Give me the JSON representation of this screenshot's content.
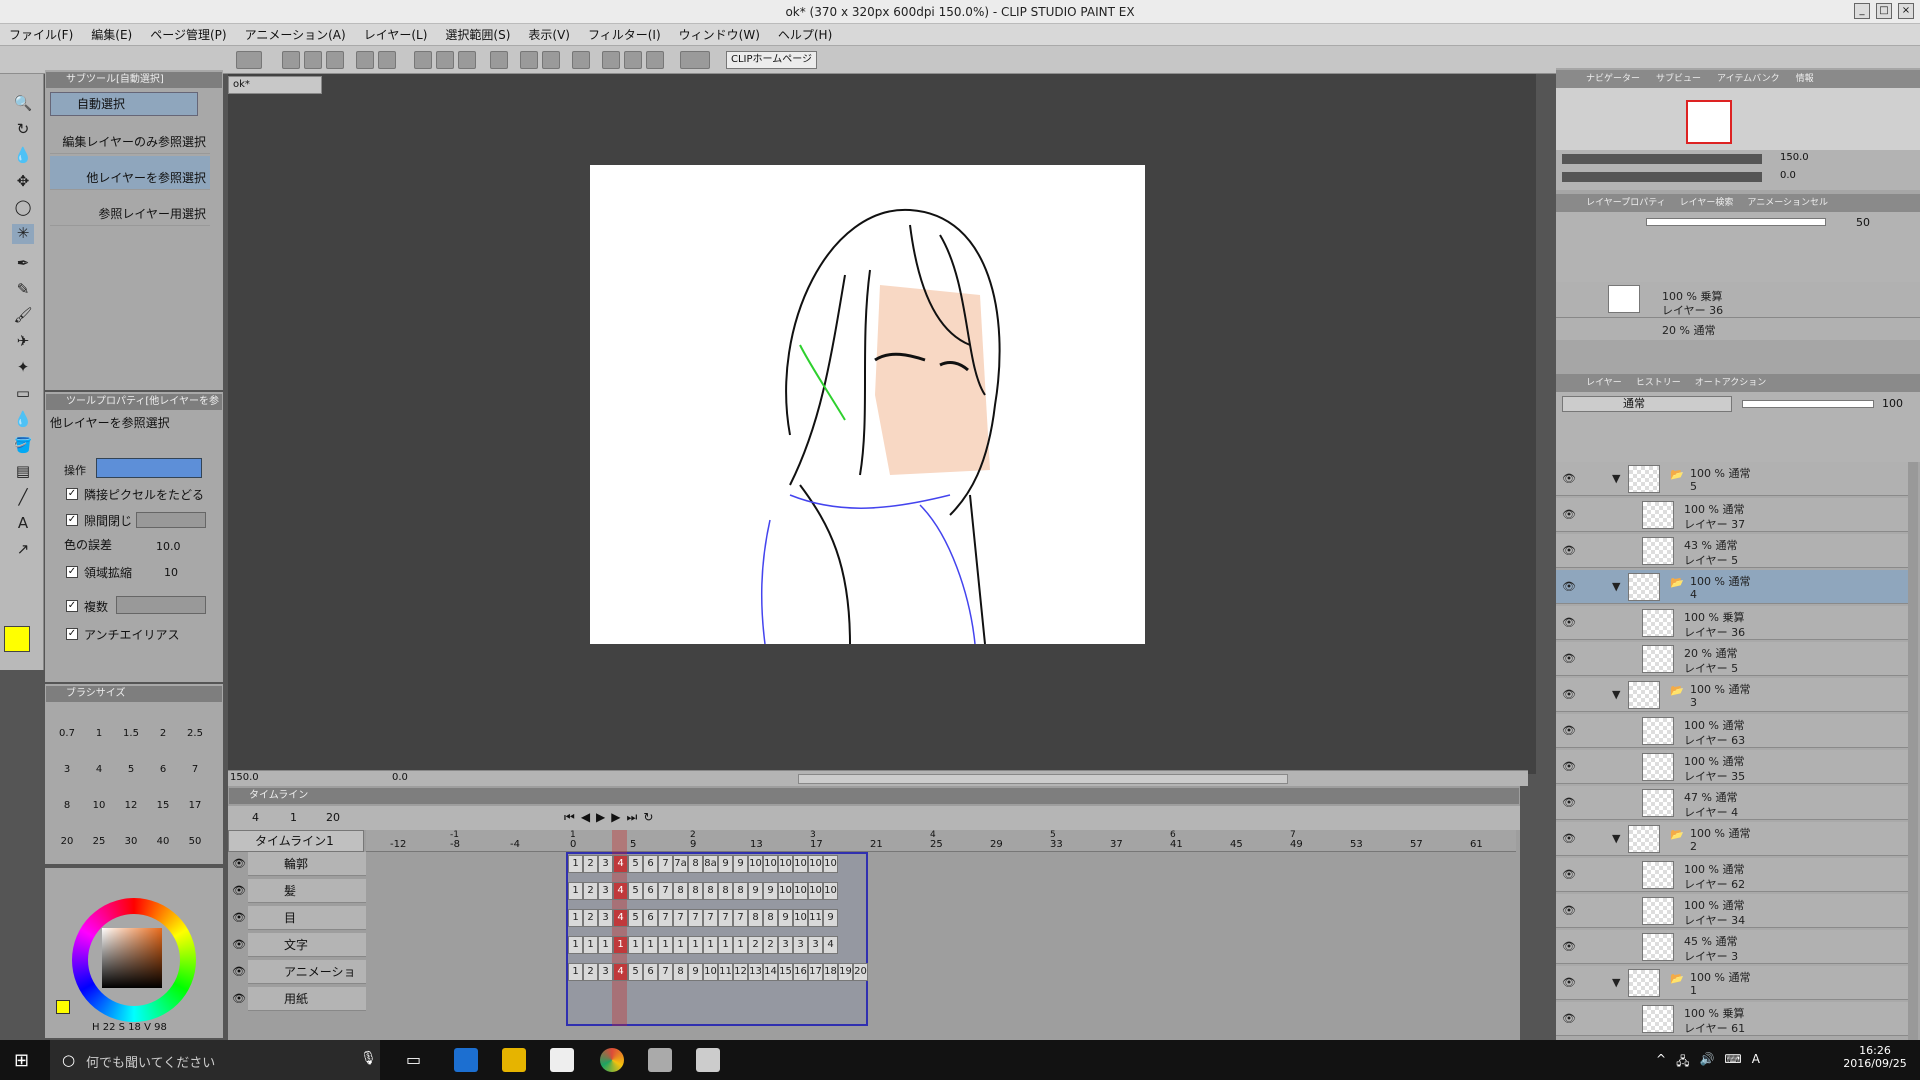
{
  "window": {
    "title": "ok* (370 x 320px 600dpi 150.0%) - CLIP STUDIO PAINT EX"
  },
  "menu": [
    "ファイル(F)",
    "編集(E)",
    "ページ管理(P)",
    "アニメーション(A)",
    "レイヤー(L)",
    "選択範囲(S)",
    "表示(V)",
    "フィルター(I)",
    "ウィンドウ(W)",
    "ヘルプ(H)"
  ],
  "toolbar": {
    "clip_home": "CLIPホームページ"
  },
  "doc_tab": "ok*",
  "subtool": {
    "header": "サブツール[自動選択]",
    "title": "自動選択",
    "items": [
      "編集レイヤーのみ参照選択",
      "他レイヤーを参照選択",
      "参照レイヤー用選択"
    ]
  },
  "toolprop": {
    "header": "ツールプロパティ[他レイヤーを参",
    "title": "他レイヤーを参照選択",
    "op_label": "操作",
    "follow": "隣接ピクセルをたどる",
    "close_gap": "隙間閉じ",
    "tolerance_label": "色の誤差",
    "tolerance_value": "10.0",
    "expand_label": "領域拡縮",
    "expand_value": "10",
    "multi_ref": "複数",
    "antialias": "アンチエイリアス"
  },
  "brushsize": {
    "header": "ブラシサイズ",
    "values": [
      "0.7",
      "1",
      "1.5",
      "2",
      "2.5",
      "3",
      "4",
      "5",
      "6",
      "7",
      "8",
      "10",
      "12",
      "15",
      "17",
      "20",
      "25",
      "30",
      "40",
      "50"
    ]
  },
  "color": {
    "h": "22",
    "s": "18",
    "v": "98",
    "main": "#ffff00",
    "sub": "#f5d5c0"
  },
  "canvas": {
    "zoom": "150.0",
    "rotate": "0.0"
  },
  "timeline": {
    "header": "タイムライン",
    "frame": "4",
    "start": "1",
    "end": "20",
    "name": "タイムライン1",
    "ruler": [
      "-12",
      "-8",
      "-4",
      "0",
      "5",
      "9",
      "13",
      "17",
      "21",
      "25",
      "29",
      "33",
      "37",
      "41",
      "45",
      "49",
      "53",
      "57",
      "61"
    ],
    "ruler_sec": [
      "-1",
      "1",
      "2",
      "3",
      "4",
      "5",
      "6",
      "7"
    ],
    "tracks": [
      {
        "name": "輪郭",
        "cells": [
          "1",
          "2",
          "3",
          "4",
          "5",
          "6",
          "7",
          "7a",
          "8",
          "8a",
          "9",
          "9",
          "10",
          "10",
          "10",
          "10",
          "10",
          "10"
        ]
      },
      {
        "name": "髪",
        "cells": [
          "1",
          "2",
          "3",
          "4",
          "5",
          "6",
          "7",
          "8",
          "8",
          "8",
          "8",
          "8",
          "9",
          "9",
          "10",
          "10",
          "10",
          "10"
        ]
      },
      {
        "name": "目",
        "cells": [
          "1",
          "2",
          "3",
          "4",
          "5",
          "6",
          "7",
          "7",
          "7",
          "7",
          "7",
          "7",
          "8",
          "8",
          "9",
          "10",
          "11",
          "9"
        ]
      },
      {
        "name": "文字",
        "cells": [
          "1",
          "1",
          "1",
          "1",
          "1",
          "1",
          "1",
          "1",
          "1",
          "1",
          "1",
          "1",
          "2",
          "2",
          "3",
          "3",
          "3",
          "4"
        ]
      },
      {
        "name": "アニメーションフォルダー",
        "cells": [
          "1",
          "2",
          "3",
          "4",
          "5",
          "6",
          "7",
          "8",
          "9",
          "10",
          "11",
          "12",
          "13",
          "14",
          "15",
          "16",
          "17",
          "18",
          "19",
          "20"
        ]
      },
      {
        "name": "用紙",
        "cells": []
      }
    ]
  },
  "navigator": {
    "tabs": [
      "ナビゲーター",
      "サブビュー",
      "アイテムバンク",
      "情報"
    ],
    "zoom": "150.0",
    "rotate": "0.0"
  },
  "animcel": {
    "tabs": [
      "レイヤープロパティ",
      "レイヤー検索",
      "アニメーションセル"
    ],
    "opacity": "50",
    "items": [
      {
        "p": "100 %",
        "mode": "乗算",
        "name": "レイヤー 36"
      },
      {
        "p": "20 %",
        "mode": "通常",
        "name": ""
      }
    ]
  },
  "layers": {
    "tabs": [
      "レイヤー",
      "ヒストリー",
      "オートアクション"
    ],
    "blend": "通常",
    "opacity": "100",
    "items": [
      {
        "p": "100 %",
        "mode": "通常",
        "name": "5",
        "folder": true,
        "indent": 0
      },
      {
        "p": "100 %",
        "mode": "通常",
        "name": "レイヤー 37",
        "folder": false,
        "indent": 1
      },
      {
        "p": "43 %",
        "mode": "通常",
        "name": "レイヤー 5",
        "folder": false,
        "indent": 1
      },
      {
        "p": "100 %",
        "mode": "通常",
        "name": "4",
        "folder": true,
        "indent": 0,
        "sel": true
      },
      {
        "p": "100 %",
        "mode": "乗算",
        "name": "レイヤー 36",
        "folder": false,
        "indent": 1
      },
      {
        "p": "20 %",
        "mode": "通常",
        "name": "レイヤー 5",
        "folder": false,
        "indent": 1
      },
      {
        "p": "100 %",
        "mode": "通常",
        "name": "3",
        "folder": true,
        "indent": 0
      },
      {
        "p": "100 %",
        "mode": "通常",
        "name": "レイヤー 63",
        "folder": false,
        "indent": 1
      },
      {
        "p": "100 %",
        "mode": "通常",
        "name": "レイヤー 35",
        "folder": false,
        "indent": 1
      },
      {
        "p": "47 %",
        "mode": "通常",
        "name": "レイヤー 4",
        "folder": false,
        "indent": 1
      },
      {
        "p": "100 %",
        "mode": "通常",
        "name": "2",
        "folder": true,
        "indent": 0
      },
      {
        "p": "100 %",
        "mode": "通常",
        "name": "レイヤー 62",
        "folder": false,
        "indent": 1
      },
      {
        "p": "100 %",
        "mode": "通常",
        "name": "レイヤー 34",
        "folder": false,
        "indent": 1
      },
      {
        "p": "45 %",
        "mode": "通常",
        "name": "レイヤー 3",
        "folder": false,
        "indent": 1
      },
      {
        "p": "100 %",
        "mode": "通常",
        "name": "1",
        "folder": true,
        "indent": 0
      },
      {
        "p": "100 %",
        "mode": "乗算",
        "name": "レイヤー 61",
        "folder": false,
        "indent": 1
      }
    ]
  },
  "taskbar": {
    "search": "何でも聞いてください",
    "time": "16:26",
    "date": "2016/09/25",
    "ime": "A"
  }
}
